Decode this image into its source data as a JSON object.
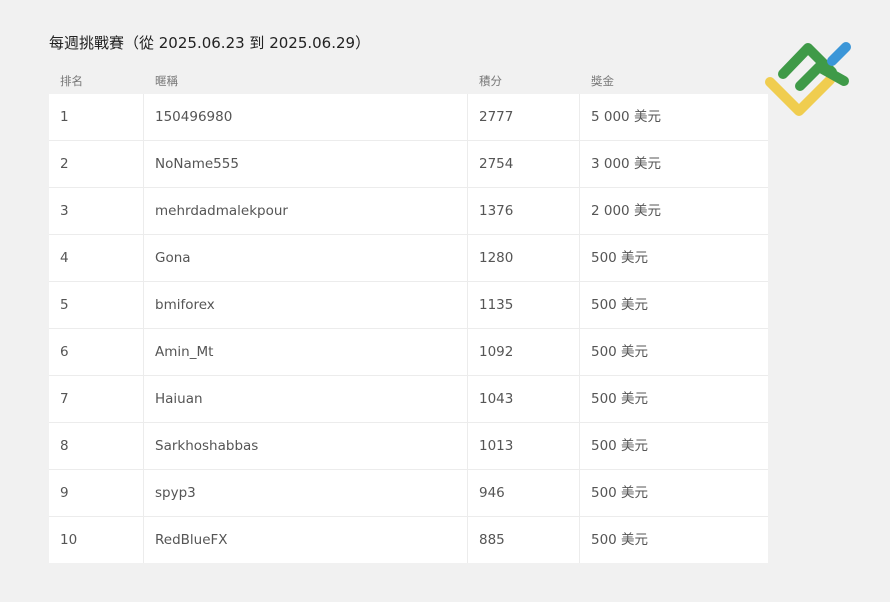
{
  "title": "每週挑戰賽（從 2025.06.23 到 2025.06.29）",
  "logo_icon": "lf-logo-icon",
  "colors": {
    "background": "#f1f1f1",
    "logo_green": "#3f9a48",
    "logo_yellow": "#f0cd4f",
    "logo_blue": "#3b96d8"
  },
  "table": {
    "headers": {
      "rank": "排名",
      "nickname": "暱稱",
      "points": "積分",
      "prize": "獎金"
    },
    "rows": [
      {
        "rank": "1",
        "nickname": "150496980",
        "points": "2777",
        "prize": "5 000 美元"
      },
      {
        "rank": "2",
        "nickname": "NoName555",
        "points": "2754",
        "prize": "3 000 美元"
      },
      {
        "rank": "3",
        "nickname": "mehrdadmalekpour",
        "points": "1376",
        "prize": "2 000 美元"
      },
      {
        "rank": "4",
        "nickname": "Gona",
        "points": "1280",
        "prize": "500 美元"
      },
      {
        "rank": "5",
        "nickname": "bmiforex",
        "points": "1135",
        "prize": "500 美元"
      },
      {
        "rank": "6",
        "nickname": "Amin_Mt",
        "points": "1092",
        "prize": "500 美元"
      },
      {
        "rank": "7",
        "nickname": "Haiuan",
        "points": "1043",
        "prize": "500 美元"
      },
      {
        "rank": "8",
        "nickname": "Sarkhoshabbas",
        "points": "1013",
        "prize": "500 美元"
      },
      {
        "rank": "9",
        "nickname": "spyp3",
        "points": "946",
        "prize": "500 美元"
      },
      {
        "rank": "10",
        "nickname": "RedBlueFX",
        "points": "885",
        "prize": "500 美元"
      }
    ]
  }
}
